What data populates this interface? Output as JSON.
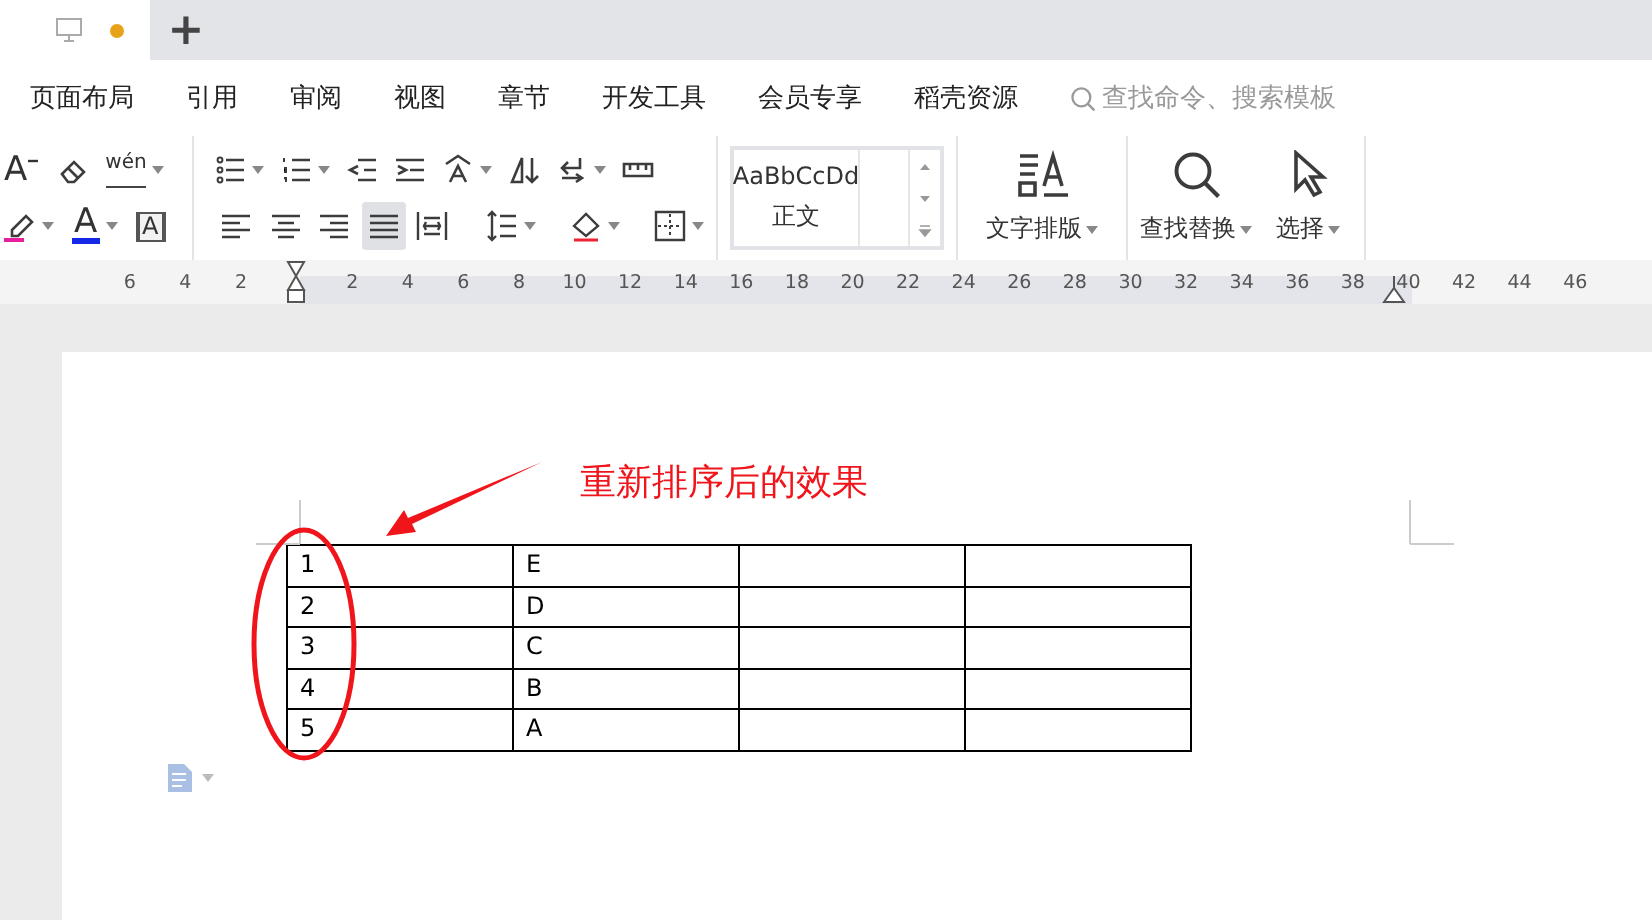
{
  "tab_bar": {
    "new_tab": "+"
  },
  "menu": [
    {
      "label": "页面布局"
    },
    {
      "label": "引用"
    },
    {
      "label": "审阅"
    },
    {
      "label": "视图"
    },
    {
      "label": "章节"
    },
    {
      "label": "开发工具"
    },
    {
      "label": "会员专享"
    },
    {
      "label": "稻壳资源"
    }
  ],
  "search": {
    "placeholder": "查找命令、搜索模板"
  },
  "toolbar": {
    "font_row1": [
      {
        "kind": "shrink",
        "glyph": "A",
        "dropdown": false
      },
      {
        "kind": "eraser",
        "dropdown": false
      },
      {
        "kind": "phonetic",
        "glyph": "wén",
        "dropdown": true
      }
    ],
    "font_row2": [
      {
        "kind": "highlight",
        "dropdown": true
      },
      {
        "kind": "color",
        "glyph": "A",
        "dropdown": true
      },
      {
        "kind": "boxed",
        "glyph": "A",
        "dropdown": false
      }
    ],
    "para_row1": [
      {
        "kind": "bullets",
        "dropdown": true
      },
      {
        "kind": "numbering",
        "dropdown": true
      },
      {
        "kind": "outdent",
        "dropdown": false
      },
      {
        "kind": "indent",
        "dropdown": false
      },
      {
        "kind": "direction",
        "dropdown": true
      },
      {
        "kind": "sort",
        "dropdown": false
      },
      {
        "kind": "linebreak",
        "dropdown": true
      },
      {
        "kind": "ruler",
        "dropdown": false
      }
    ],
    "align": [
      {
        "kind": "left",
        "selected": false
      },
      {
        "kind": "center",
        "selected": false
      },
      {
        "kind": "right",
        "selected": false
      },
      {
        "kind": "justify",
        "selected": true
      },
      {
        "kind": "distribute",
        "selected": false
      }
    ],
    "para_row2": [
      {
        "kind": "spacing",
        "dropdown": true
      },
      {
        "kind": "shading",
        "dropdown": true
      },
      {
        "kind": "borders",
        "dropdown": true
      }
    ],
    "style_box": {
      "preview": "AaBbCcDd",
      "name": "正文"
    },
    "big_buttons": [
      {
        "kind": "layout",
        "label": "文字排版"
      },
      {
        "kind": "find",
        "label": "查找替换"
      },
      {
        "kind": "select",
        "label": "选择"
      }
    ]
  },
  "ruler": {
    "left_labels": [
      "6",
      "4",
      "2"
    ],
    "right_labels": [
      "2",
      "4",
      "6",
      "8",
      "10",
      "12",
      "14",
      "16",
      "18",
      "20",
      "22",
      "24",
      "26",
      "28",
      "30",
      "32",
      "34",
      "36",
      "38",
      "40",
      "42",
      "44",
      "46"
    ]
  },
  "document": {
    "annotation": "重新排序后的效果",
    "table": {
      "rows": [
        {
          "number": "1",
          "letter": "E"
        },
        {
          "number": "2",
          "letter": "D"
        },
        {
          "number": "3",
          "letter": "C"
        },
        {
          "number": "4",
          "letter": "B"
        },
        {
          "number": "5",
          "letter": "A"
        }
      ]
    }
  }
}
